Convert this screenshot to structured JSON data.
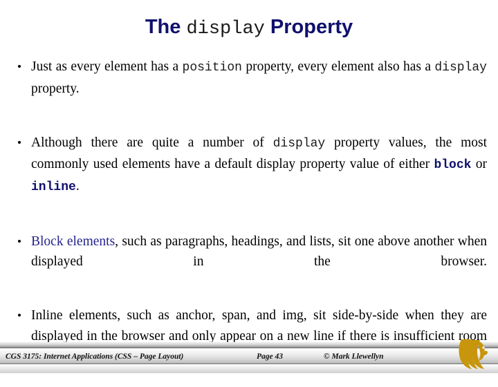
{
  "slide": {
    "title": {
      "part1": "The ",
      "code": "display",
      "part2": " Property"
    },
    "bullets": [
      {
        "id": "bullet-position-display",
        "segments": [
          {
            "text": "Just as every element has a ",
            "style": "normal"
          },
          {
            "text": "position",
            "style": "mono"
          },
          {
            "text": " property, every element also has a ",
            "style": "normal"
          },
          {
            "text": "display",
            "style": "mono"
          },
          {
            "text": " property.",
            "style": "normal"
          }
        ]
      },
      {
        "id": "bullet-default-values",
        "segments": [
          {
            "text": "Although there are quite a number of ",
            "style": "normal"
          },
          {
            "text": "display",
            "style": "mono"
          },
          {
            "text": " property values, the most commonly used elements have a default display property value of either ",
            "style": "normal"
          },
          {
            "text": "block",
            "style": "mono-bold"
          },
          {
            "text": " or ",
            "style": "normal"
          },
          {
            "text": "inline",
            "style": "mono-bold"
          },
          {
            "text": ".",
            "style": "normal"
          }
        ]
      },
      {
        "id": "bullet-block-elements",
        "segments": [
          {
            "text": "Block elements",
            "style": "navy"
          },
          {
            "text": ", such as paragraphs, headings, and lists, sit one above another when displayed in the browser.",
            "style": "normal"
          }
        ]
      },
      {
        "id": "bullet-inline-elements",
        "segments": [
          {
            "text": "Inline elements, such as anchor, span, and img, sit side-by-side when they are displayed in the browser and only appear on a new line if there is insufficient room on the previous line.",
            "style": "normal"
          }
        ]
      }
    ]
  },
  "footer": {
    "course": "CGS 3175: Internet Applications (CSS – Page Layout)",
    "page": "Page 43",
    "copyright": "© Mark Llewellyn",
    "logo_name": "ucf-pegasus-logo"
  },
  "colors": {
    "title_navy": "#10106e",
    "accent_navy": "#23238e",
    "code_black": "#1a1a1a",
    "logo_gold": "#c8960c",
    "background": "#ffffff"
  }
}
